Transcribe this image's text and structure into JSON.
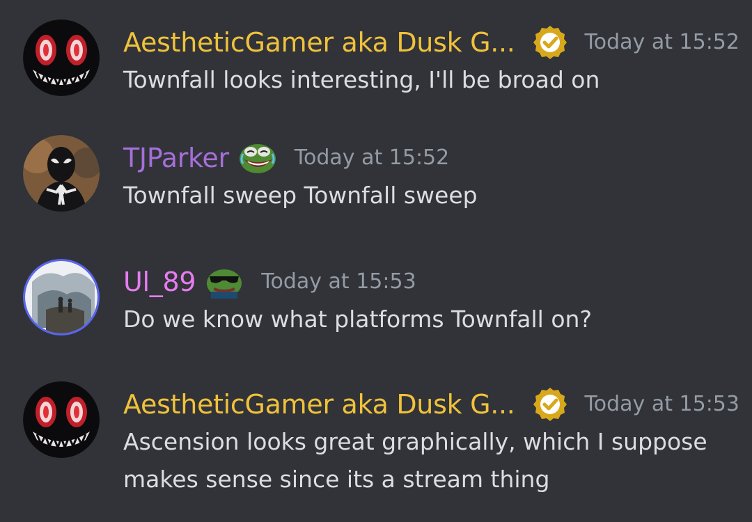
{
  "colors": {
    "background": "#313338",
    "username_gold": "#f0c23b",
    "username_purple": "#a66fd9",
    "username_pink": "#e77cf0",
    "timestamp": "#949ba4",
    "message_text": "#dbdee1",
    "verified_badge": "#d8a81c"
  },
  "messages": [
    {
      "author": "AestheticGamer aka Dusk G...",
      "badge_icon": "verified-check-icon",
      "timestamp": "Today at 15:52",
      "lines": [
        "Townfall looks interesting, I'll be broad on"
      ]
    },
    {
      "author": "TJParker",
      "emoji_icon": "pepe-crying-laugh-icon",
      "timestamp": "Today at 15:52",
      "lines": [
        "Townfall sweep Townfall sweep"
      ]
    },
    {
      "author": "Ul_89",
      "emoji_icon": "pepe-sunglasses-icon",
      "timestamp": "Today at 15:53",
      "lines": [
        "Do we know what platforms Townfall on?"
      ]
    },
    {
      "author": "AestheticGamer aka Dusk G...",
      "badge_icon": "verified-check-icon",
      "timestamp": "Today at 15:53",
      "lines": [
        "Ascension looks great graphically, which I suppose",
        "makes sense since its a stream thing"
      ]
    }
  ]
}
